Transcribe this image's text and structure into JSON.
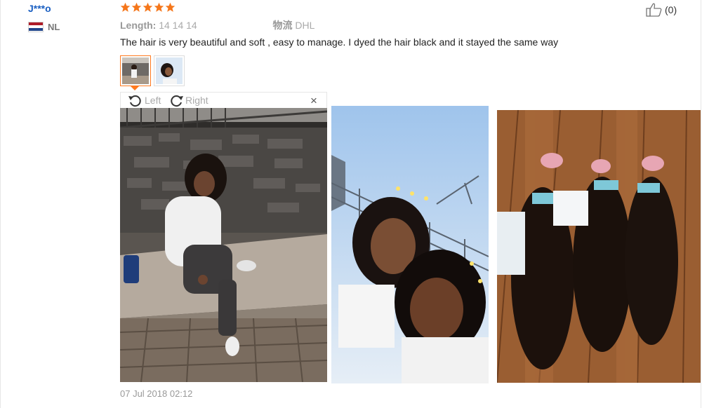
{
  "review": {
    "username": "J***o",
    "country_code": "NL",
    "flag_colors": [
      "#ae1c28",
      "#ffffff",
      "#21468b"
    ],
    "rating": 5,
    "star_color": "#f5761a",
    "attributes": {
      "length_label": "Length:",
      "length_value": "14 14 14",
      "shipping_label": "物流",
      "shipping_value": "DHL"
    },
    "helpful_icon": "thumbs-up-icon",
    "helpful_count": "(0)",
    "text": "The hair is very beautiful and soft , easy to manage. I dyed the hair black and it stayed the same way",
    "date": "07 Jul 2018 02:12"
  },
  "viewer": {
    "rotate_left_label": "Left",
    "rotate_right_label": "Right",
    "close_label": "×",
    "rotate_left_icon": "rotate-left-icon",
    "rotate_right_icon": "rotate-right-icon"
  },
  "photos": [
    {
      "name": "photo-woman-on-bench"
    },
    {
      "name": "photo-selfie"
    },
    {
      "name": "photo-hair-bundles"
    }
  ]
}
